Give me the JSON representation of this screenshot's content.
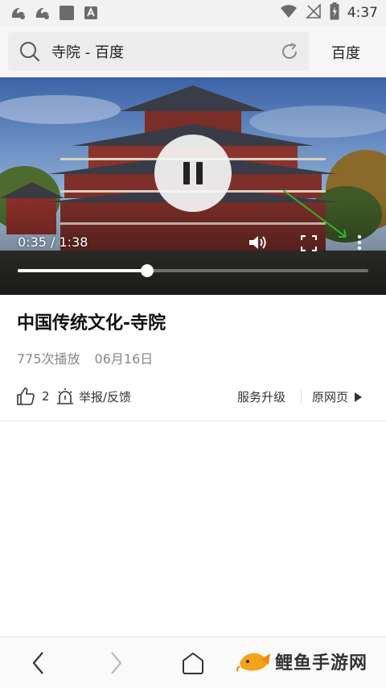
{
  "status_bar": {
    "time": "4:37",
    "left_icons": [
      "uc-browser-icon",
      "uc-browser-icon",
      "app-square-icon",
      "a-square-icon"
    ],
    "right_icons": [
      "wifi-icon",
      "no-signal-icon",
      "battery-charging-icon"
    ]
  },
  "search": {
    "query": "寺院 - 百度",
    "search_engine_label": "百度"
  },
  "video": {
    "time_display": "0:35 / 1:38",
    "progress_fraction": 0.37,
    "accent": "#ffffff",
    "annotation_arrow_color": "#2fb52f"
  },
  "info": {
    "title": "中国传统文化-寺院",
    "plays": "775次播放",
    "date": "06月16日",
    "like_count": "2",
    "report_label": "举报/反馈",
    "upgrade_label": "服务升级",
    "original_page_label": "原网页"
  },
  "bottom_nav": {
    "brand_text": "鲤鱼手游网"
  }
}
